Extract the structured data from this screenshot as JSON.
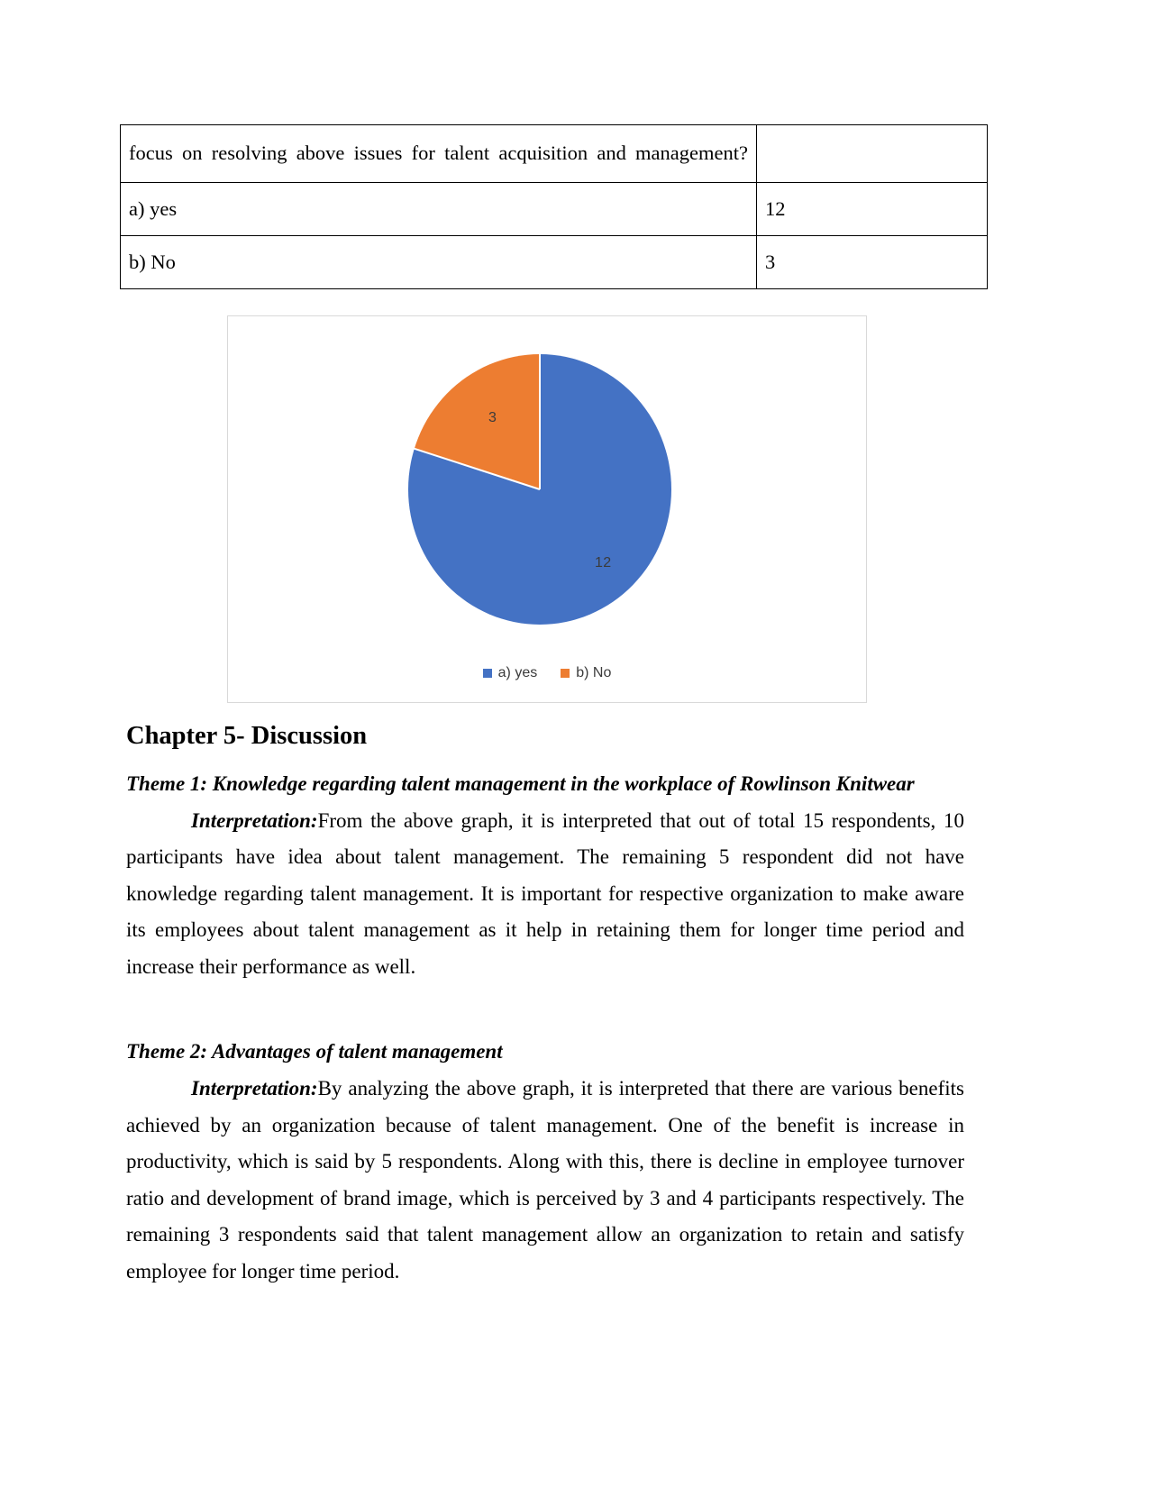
{
  "colors": {
    "series_blue": "#4472C4",
    "series_orange": "#ED7D31",
    "chart_border": "#D9D9D9",
    "label_text": "#3B3B3B"
  },
  "table": {
    "question": "focus on resolving above issues for talent acquisition and management?",
    "question_count": "",
    "rows": [
      {
        "label": "a) yes",
        "count": "12"
      },
      {
        "label": "b) No",
        "count": "3"
      }
    ]
  },
  "chart_data": {
    "type": "pie",
    "title": "",
    "categories": [
      "a) yes",
      "b) No"
    ],
    "values": [
      12,
      3
    ],
    "data_labels": [
      "12",
      "3"
    ],
    "colors": [
      "#4472C4",
      "#ED7D31"
    ],
    "legend": {
      "position": "bottom",
      "entries": [
        "a) yes",
        "b) No"
      ]
    },
    "start_angle_deg": 0,
    "total": 15,
    "grid": false
  },
  "document": {
    "chapter_heading": "Chapter 5- Discussion",
    "theme1": {
      "heading": "Theme 1: Knowledge regarding talent management in the workplace of Rowlinson Knitwear",
      "lead": "Interpretation:",
      "body": "From the above graph, it is interpreted that out of total 15 respondents, 10 participants have idea about talent management. The remaining 5 respondent did not have knowledge regarding talent management. It is important for respective organization to make aware its employees about talent management as it help in retaining them for longer time period and increase their performance as well."
    },
    "theme2": {
      "heading": "Theme 2: Advantages of talent management",
      "lead": "Interpretation:",
      "body": "By analyzing the above graph, it is interpreted that there are various benefits achieved by an organization because of talent management. One of the benefit is increase in productivity, which is said by 5 respondents. Along with this, there is decline in employee turnover ratio and development of brand image, which is perceived by 3 and 4 participants respectively. The remaining 3 respondents said that talent management allow an organization to retain and satisfy employee for longer time period."
    }
  }
}
